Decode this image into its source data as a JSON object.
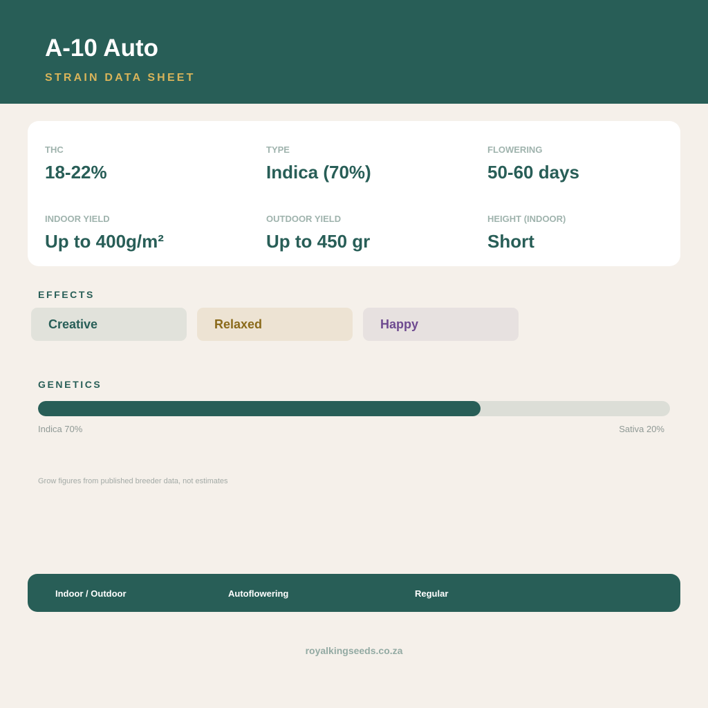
{
  "header": {
    "title": "A-10 Auto",
    "subtitle": "STRAIN DATA SHEET",
    "background_color": "#285e57",
    "subtitle_color": "#d9b45a"
  },
  "stats": [
    {
      "label": "THC",
      "value": "18-22%"
    },
    {
      "label": "TYPE",
      "value": "Indica (70%)"
    },
    {
      "label": "FLOWERING",
      "value": "50-60 days"
    },
    {
      "label": "INDOOR YIELD",
      "value": "Up to 400g/m²"
    },
    {
      "label": "OUTDOOR YIELD",
      "value": "Up to 450 gr"
    },
    {
      "label": "HEIGHT (INDOOR)",
      "value": "Short"
    }
  ],
  "effects": {
    "label": "EFFECTS",
    "items": [
      {
        "name": "Creative",
        "bg": "#e1e2db",
        "color": "#285e57"
      },
      {
        "name": "Relaxed",
        "bg": "#ede3d3",
        "color": "#8a6a1a"
      },
      {
        "name": "Happy",
        "bg": "#e7e1e0",
        "color": "#6e4a90"
      }
    ]
  },
  "genetics": {
    "label": "GENETICS",
    "indica_percent": 70,
    "sativa_percent": 20,
    "left_label": "Indica 70%",
    "right_label": "Sativa 20%",
    "fill_color": "#285e57",
    "track_color": "#dcded7"
  },
  "footnote": "Grow figures from published breeder data, not estimates",
  "footer": {
    "items": [
      "Indoor / Outdoor",
      "Autoflowering",
      "Regular"
    ]
  },
  "website": "royalkingseeds.co.za"
}
